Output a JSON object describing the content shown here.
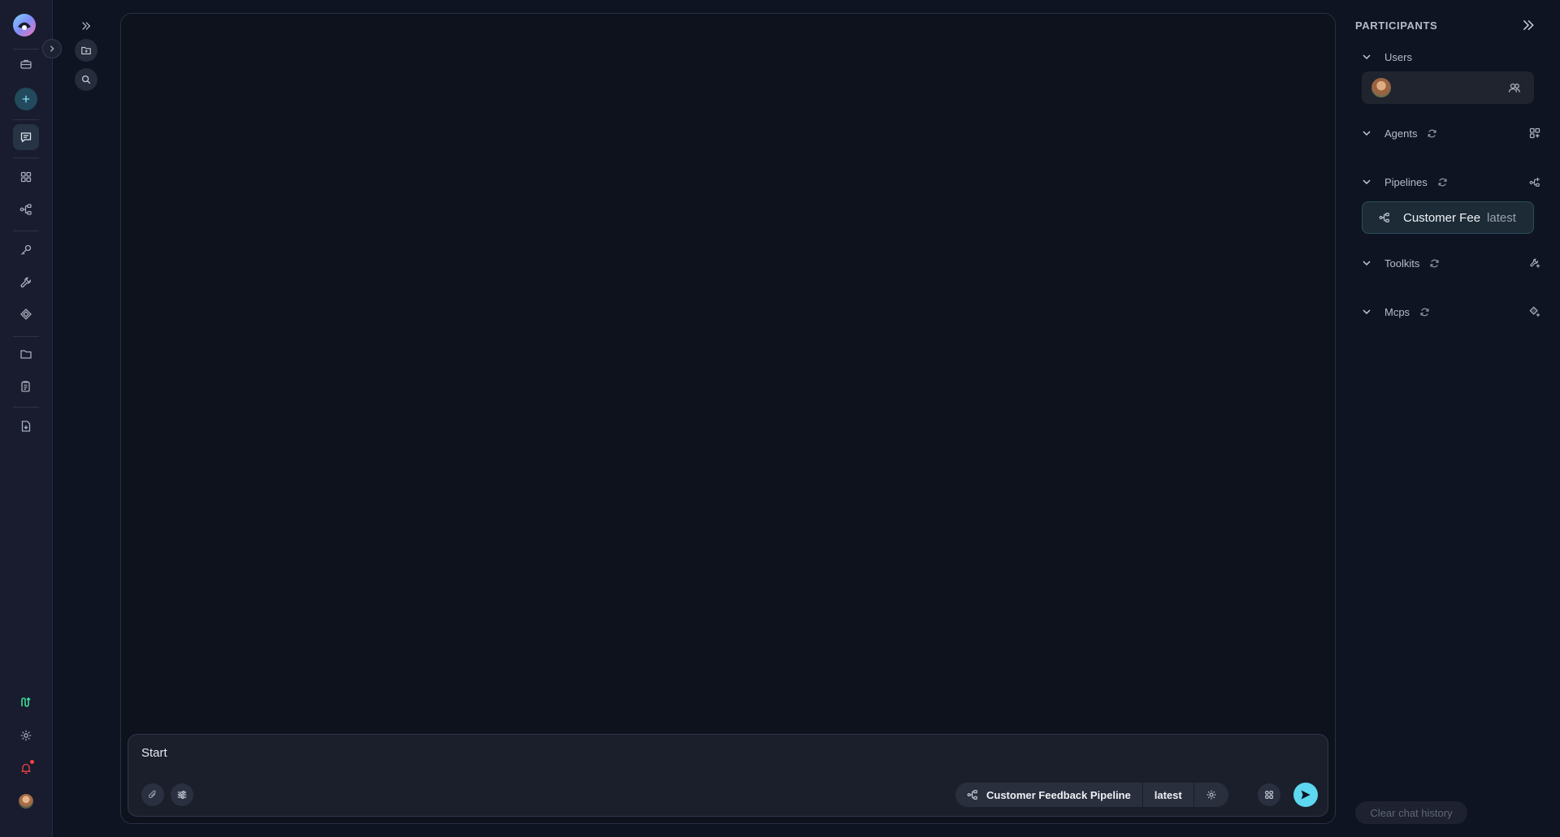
{
  "composer": {
    "message_value": "Start",
    "pipeline_name": "Customer Feedback Pipeline",
    "pipeline_version": "latest"
  },
  "participants": {
    "title": "PARTICIPANTS",
    "sections": {
      "users": "Users",
      "agents": "Agents",
      "pipelines": "Pipelines",
      "toolkits": "Toolkits",
      "mcps": "Mcps"
    },
    "pipeline_card": {
      "name": "Customer Fee",
      "version": "latest"
    }
  },
  "clear_history_label": "Clear chat history",
  "icons": {
    "rail": [
      "logo-icon",
      "briefcase-icon",
      "plus-icon",
      "chat-icon",
      "grid-icon",
      "pipeline-icon",
      "key-icon",
      "wrench-icon",
      "tag-icon",
      "folder-icon",
      "clipboard-icon",
      "document-icon",
      "graph-icon",
      "settings-icon",
      "bell-icon",
      "avatar"
    ],
    "secondary": [
      "expand-icon",
      "new-folder-icon",
      "search-icon"
    ]
  },
  "colors": {
    "background": "#0e1421",
    "rail": "#181c2e",
    "accent": "#5ed7f0",
    "add_button": "#22495c",
    "graph_icon": "#3ddc97",
    "notification": "#ef4444"
  }
}
